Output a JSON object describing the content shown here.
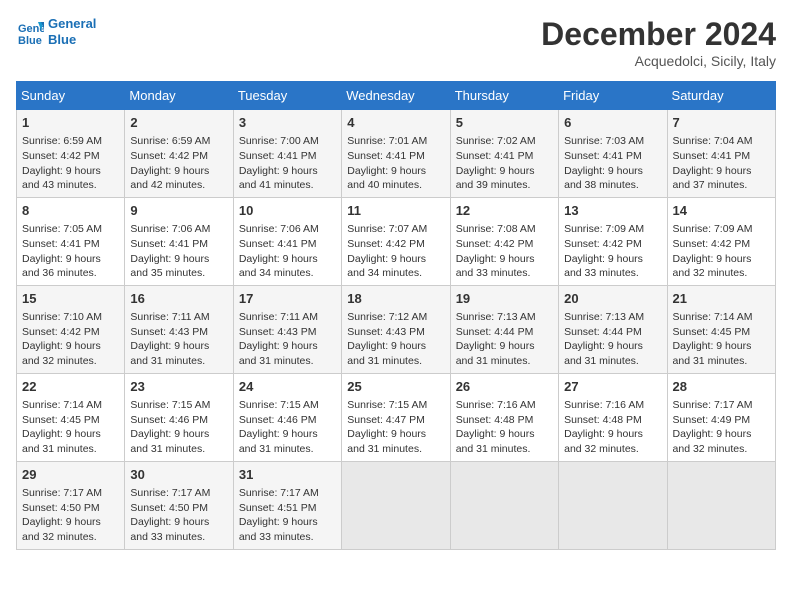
{
  "header": {
    "logo_line1": "General",
    "logo_line2": "Blue",
    "month": "December 2024",
    "location": "Acquedolci, Sicily, Italy"
  },
  "columns": [
    "Sunday",
    "Monday",
    "Tuesday",
    "Wednesday",
    "Thursday",
    "Friday",
    "Saturday"
  ],
  "weeks": [
    [
      {
        "day": "1",
        "rise": "6:59 AM",
        "set": "4:42 PM",
        "daylight": "9 hours and 43 minutes."
      },
      {
        "day": "2",
        "rise": "6:59 AM",
        "set": "4:42 PM",
        "daylight": "9 hours and 42 minutes."
      },
      {
        "day": "3",
        "rise": "7:00 AM",
        "set": "4:41 PM",
        "daylight": "9 hours and 41 minutes."
      },
      {
        "day": "4",
        "rise": "7:01 AM",
        "set": "4:41 PM",
        "daylight": "9 hours and 40 minutes."
      },
      {
        "day": "5",
        "rise": "7:02 AM",
        "set": "4:41 PM",
        "daylight": "9 hours and 39 minutes."
      },
      {
        "day": "6",
        "rise": "7:03 AM",
        "set": "4:41 PM",
        "daylight": "9 hours and 38 minutes."
      },
      {
        "day": "7",
        "rise": "7:04 AM",
        "set": "4:41 PM",
        "daylight": "9 hours and 37 minutes."
      }
    ],
    [
      {
        "day": "8",
        "rise": "7:05 AM",
        "set": "4:41 PM",
        "daylight": "9 hours and 36 minutes."
      },
      {
        "day": "9",
        "rise": "7:06 AM",
        "set": "4:41 PM",
        "daylight": "9 hours and 35 minutes."
      },
      {
        "day": "10",
        "rise": "7:06 AM",
        "set": "4:41 PM",
        "daylight": "9 hours and 34 minutes."
      },
      {
        "day": "11",
        "rise": "7:07 AM",
        "set": "4:42 PM",
        "daylight": "9 hours and 34 minutes."
      },
      {
        "day": "12",
        "rise": "7:08 AM",
        "set": "4:42 PM",
        "daylight": "9 hours and 33 minutes."
      },
      {
        "day": "13",
        "rise": "7:09 AM",
        "set": "4:42 PM",
        "daylight": "9 hours and 33 minutes."
      },
      {
        "day": "14",
        "rise": "7:09 AM",
        "set": "4:42 PM",
        "daylight": "9 hours and 32 minutes."
      }
    ],
    [
      {
        "day": "15",
        "rise": "7:10 AM",
        "set": "4:42 PM",
        "daylight": "9 hours and 32 minutes."
      },
      {
        "day": "16",
        "rise": "7:11 AM",
        "set": "4:43 PM",
        "daylight": "9 hours and 31 minutes."
      },
      {
        "day": "17",
        "rise": "7:11 AM",
        "set": "4:43 PM",
        "daylight": "9 hours and 31 minutes."
      },
      {
        "day": "18",
        "rise": "7:12 AM",
        "set": "4:43 PM",
        "daylight": "9 hours and 31 minutes."
      },
      {
        "day": "19",
        "rise": "7:13 AM",
        "set": "4:44 PM",
        "daylight": "9 hours and 31 minutes."
      },
      {
        "day": "20",
        "rise": "7:13 AM",
        "set": "4:44 PM",
        "daylight": "9 hours and 31 minutes."
      },
      {
        "day": "21",
        "rise": "7:14 AM",
        "set": "4:45 PM",
        "daylight": "9 hours and 31 minutes."
      }
    ],
    [
      {
        "day": "22",
        "rise": "7:14 AM",
        "set": "4:45 PM",
        "daylight": "9 hours and 31 minutes."
      },
      {
        "day": "23",
        "rise": "7:15 AM",
        "set": "4:46 PM",
        "daylight": "9 hours and 31 minutes."
      },
      {
        "day": "24",
        "rise": "7:15 AM",
        "set": "4:46 PM",
        "daylight": "9 hours and 31 minutes."
      },
      {
        "day": "25",
        "rise": "7:15 AM",
        "set": "4:47 PM",
        "daylight": "9 hours and 31 minutes."
      },
      {
        "day": "26",
        "rise": "7:16 AM",
        "set": "4:48 PM",
        "daylight": "9 hours and 31 minutes."
      },
      {
        "day": "27",
        "rise": "7:16 AM",
        "set": "4:48 PM",
        "daylight": "9 hours and 32 minutes."
      },
      {
        "day": "28",
        "rise": "7:17 AM",
        "set": "4:49 PM",
        "daylight": "9 hours and 32 minutes."
      }
    ],
    [
      {
        "day": "29",
        "rise": "7:17 AM",
        "set": "4:50 PM",
        "daylight": "9 hours and 32 minutes."
      },
      {
        "day": "30",
        "rise": "7:17 AM",
        "set": "4:50 PM",
        "daylight": "9 hours and 33 minutes."
      },
      {
        "day": "31",
        "rise": "7:17 AM",
        "set": "4:51 PM",
        "daylight": "9 hours and 33 minutes."
      },
      null,
      null,
      null,
      null
    ]
  ],
  "labels": {
    "sunrise": "Sunrise:",
    "sunset": "Sunset:",
    "daylight": "Daylight:"
  }
}
